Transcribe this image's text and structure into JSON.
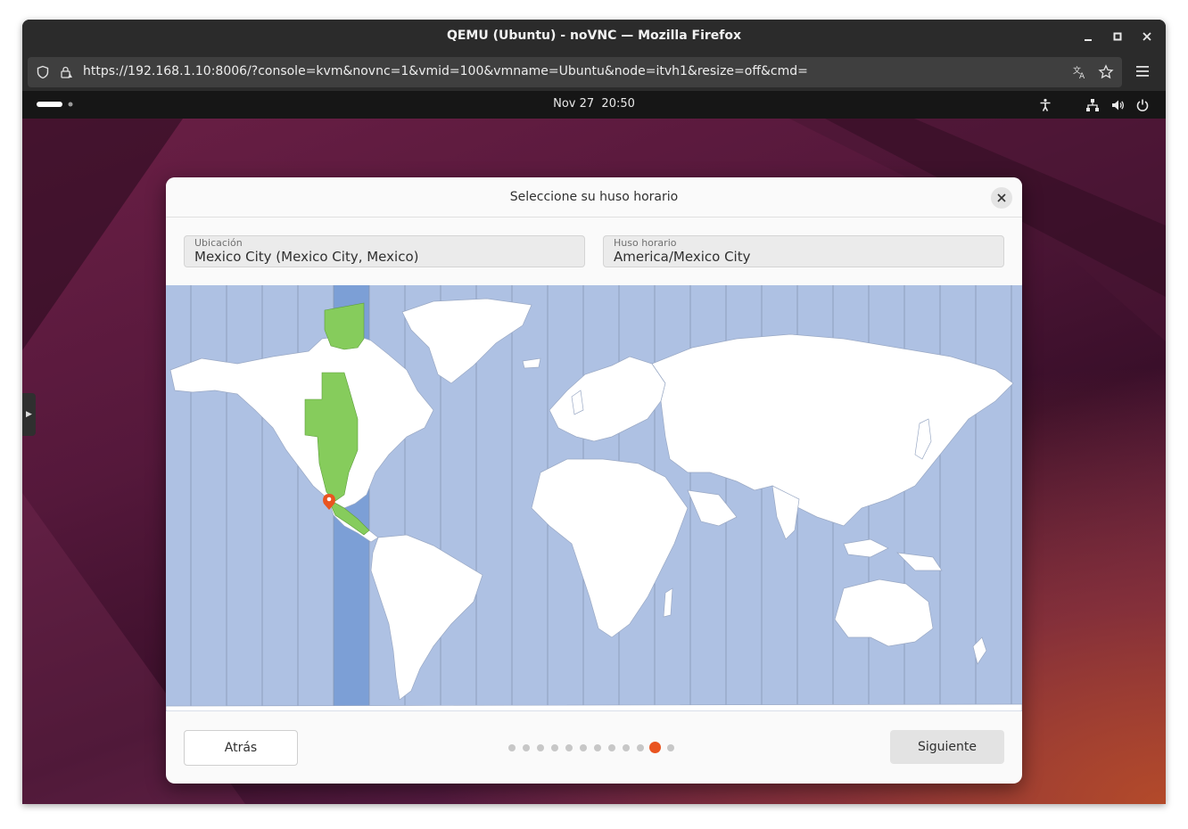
{
  "window": {
    "title": "QEMU (Ubuntu) - noVNC — Mozilla Firefox",
    "minimize_icon": "minimize-icon",
    "maximize_icon": "maximize-icon",
    "close_icon": "close-icon"
  },
  "browser": {
    "url": "https://192.168.1.10:8006/?console=kvm&novnc=1&vmid=100&vmname=Ubuntu&node=itvh1&resize=off&cmd=",
    "icons": [
      "shield-icon",
      "lock-warning-icon",
      "translate-icon",
      "bookmark-star-icon",
      "hamburger-menu-icon"
    ]
  },
  "topbar": {
    "date": "Nov 27",
    "time": "20:50",
    "icons": [
      "accessibility-icon",
      "network-icon",
      "volume-icon",
      "power-icon"
    ]
  },
  "dialog": {
    "title": "Seleccione su huso horario",
    "location_label": "Ubicación",
    "location_value": "Mexico City (Mexico City, Mexico)",
    "timezone_label": "Huso horario",
    "timezone_value": "America/Mexico City",
    "back_button": "Atrás",
    "next_button": "Siguiente",
    "progress": {
      "total_steps": 12,
      "current_step": 11
    }
  },
  "colors": {
    "accent": "#e95420",
    "map_ocean": "#aec1e3",
    "map_selected_zone": "#7c9fd6",
    "map_selected_land": "#86cc5c",
    "map_land": "#ffffff"
  }
}
